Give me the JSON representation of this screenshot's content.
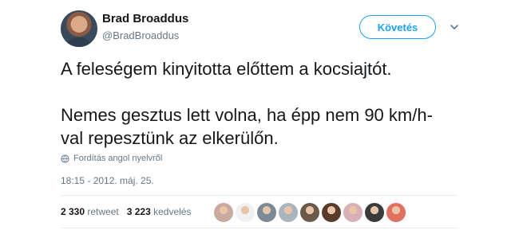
{
  "author": {
    "name": "Brad Broaddus",
    "handle": "@BradBroaddus"
  },
  "follow_label": "Követés",
  "tweet": {
    "text": "A feleségem kinyitotta előttem a kocsiajtót.\n\nNemes gesztus lett volna, ha épp nem 90 km/h-val repesztünk az elkerülőn."
  },
  "translate_label": "Fordítás angol nyelvről",
  "timestamp": "18:15 - 2012. máj. 25.",
  "stats": {
    "retweets_count": "2 330",
    "retweets_label": "retweet",
    "likes_count": "3 223",
    "likes_label": "kedvelés"
  },
  "likers": [
    {
      "icon": "avatar-1",
      "color": "#c9a9a0"
    },
    {
      "icon": "avatar-2",
      "color": "#f1f1f1"
    },
    {
      "icon": "avatar-3",
      "color": "#7a8a96"
    },
    {
      "icon": "avatar-4",
      "color": "#aab4bd"
    },
    {
      "icon": "avatar-5",
      "color": "#6b5a4a"
    },
    {
      "icon": "avatar-6",
      "color": "#5a3a2a"
    },
    {
      "icon": "avatar-7",
      "color": "#d9b0b8"
    },
    {
      "icon": "avatar-8",
      "color": "#3a3a3a"
    },
    {
      "icon": "avatar-9",
      "color": "#e07060"
    }
  ]
}
